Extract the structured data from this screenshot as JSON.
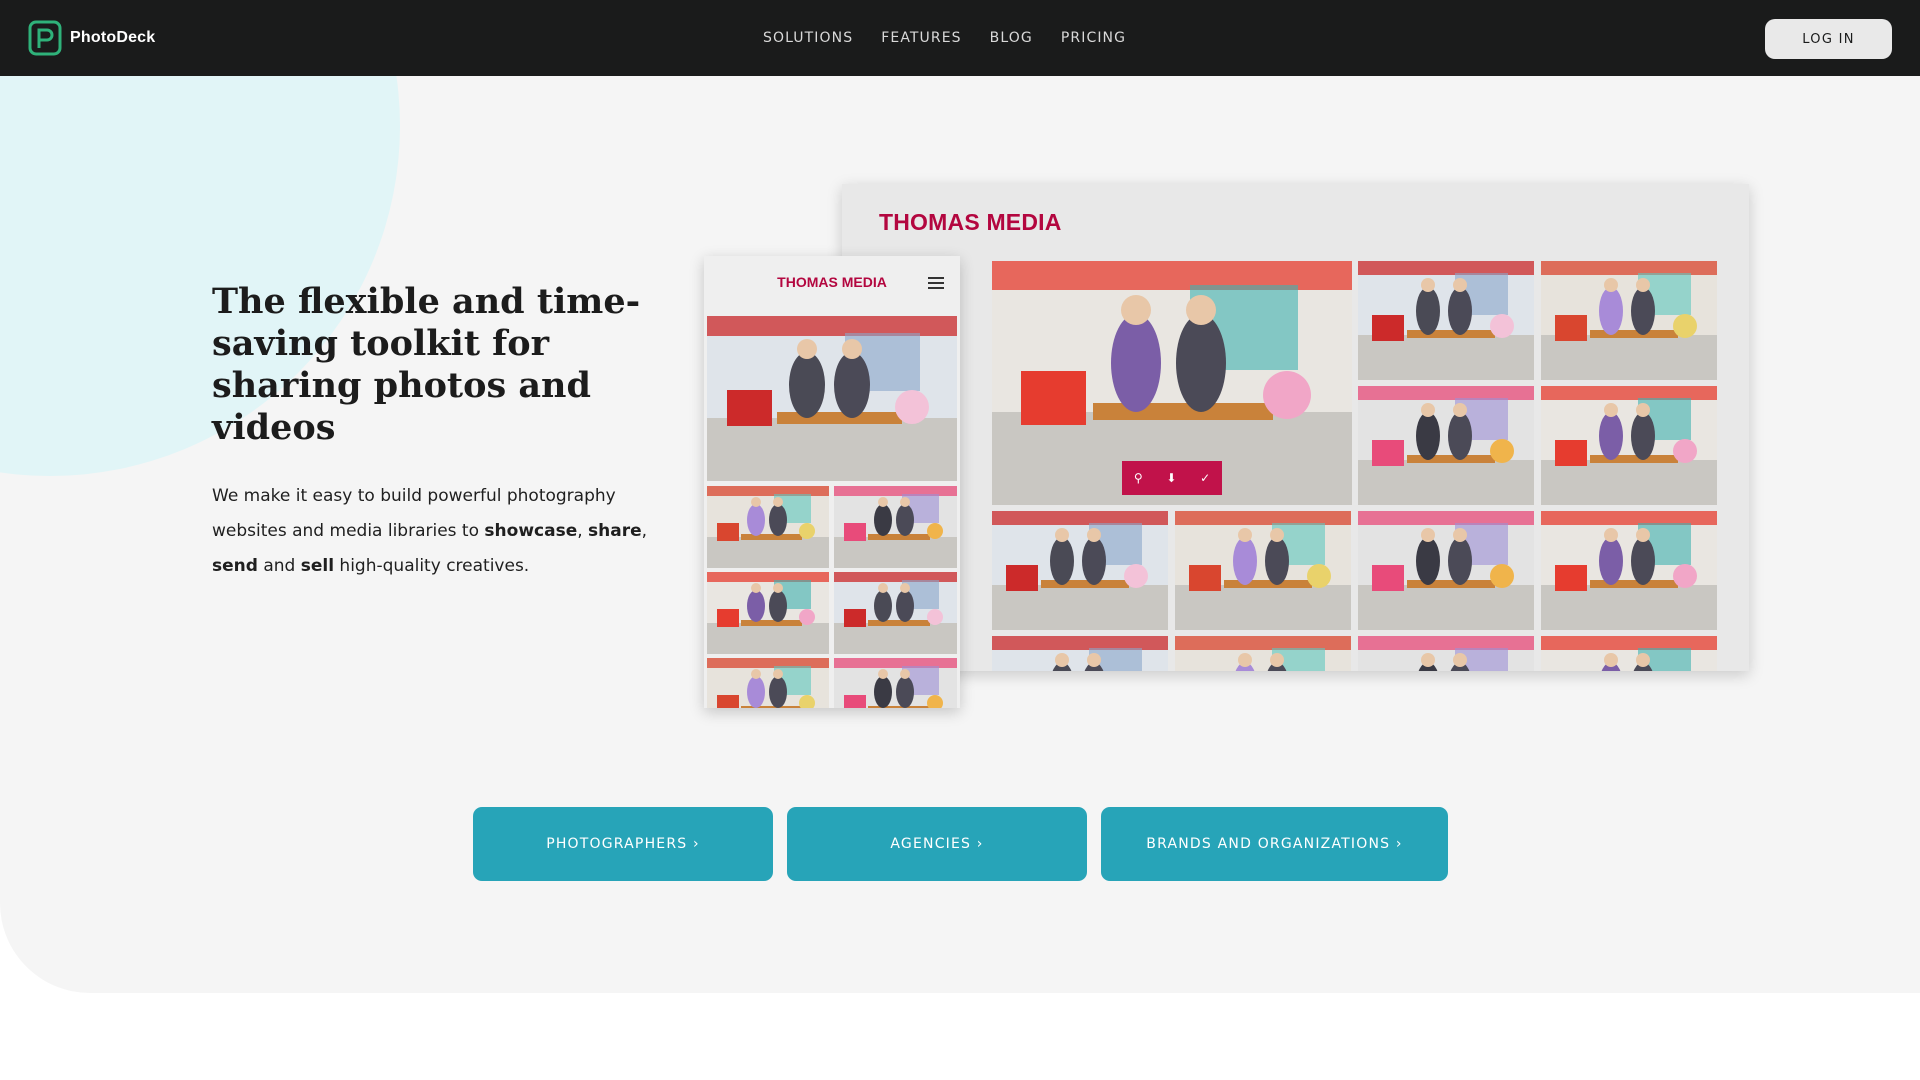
{
  "nav": {
    "brand": "PhotoDeck",
    "links": [
      "SOLUTIONS",
      "FEATURES",
      "BLOG",
      "PRICING"
    ],
    "login": "LOG IN"
  },
  "hero": {
    "headline": "The flexible and time-saving toolkit for sharing photos and videos",
    "lead": {
      "part1": "We make it easy to build powerful photography websites and media libraries to ",
      "showcase": "showcase",
      "comma": ", ",
      "share": "share",
      "sep": ", ",
      "send": "send",
      "and": " and ",
      "sell": "sell",
      "part2": " high-quality creatives."
    }
  },
  "mockup": {
    "desktop_title": "THOMAS MEDIA",
    "mobile_title": "THOMAS MEDIA",
    "toolbar_icons": [
      "search-icon",
      "pin-icon",
      "check-icon"
    ],
    "toolbar_glyphs": [
      "⚲",
      "⬇",
      "✓"
    ]
  },
  "ctas": [
    "PHOTOGRAPHERS ›",
    "AGENCIES ›",
    "BRANDS AND ORGANIZATIONS ›"
  ],
  "colors": {
    "nav_bg": "#1a1b1b",
    "hero_bg": "#f5f5f5",
    "accent_teal": "#27a4b8",
    "brand_red": "#b3063f",
    "logo_green": "#2fb27a"
  }
}
